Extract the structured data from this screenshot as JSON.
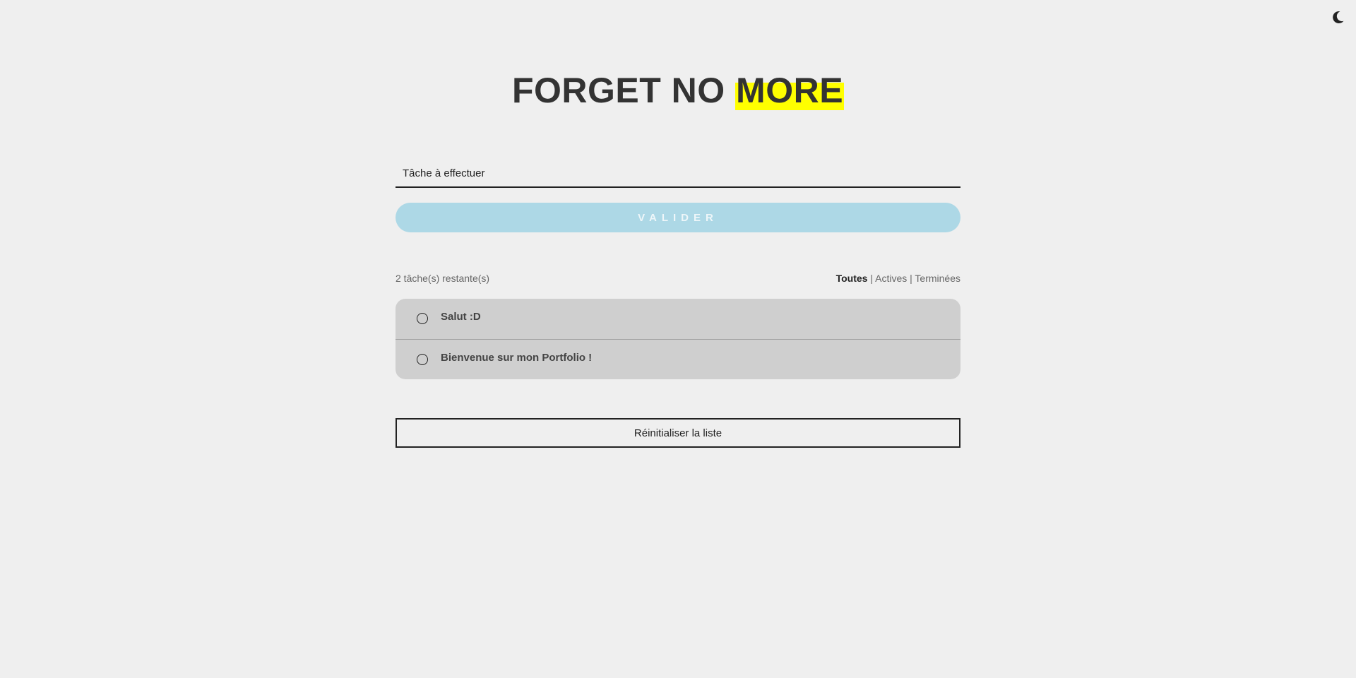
{
  "header": {
    "title_part1": "FORGET NO ",
    "title_highlight": "MORE",
    "theme_icon": "moon-icon"
  },
  "form": {
    "input_placeholder": "Tâche à effectuer",
    "input_value": "",
    "submit_label": "VALIDER"
  },
  "status": {
    "remaining_text": "2 tâche(s) restante(s)"
  },
  "filters": [
    {
      "label": "Toutes",
      "active": true
    },
    {
      "label": "Actives",
      "active": false
    },
    {
      "label": "Terminées",
      "active": false
    }
  ],
  "filter_separator": "|",
  "tasks": [
    {
      "label": "Salut :D",
      "done": false
    },
    {
      "label": "Bienvenue sur mon Portfolio !",
      "done": false
    }
  ],
  "reset_label": "Réinitialiser la liste",
  "colors": {
    "background": "#efefef",
    "highlight": "#ffff00",
    "submit_button": "#add8e6",
    "task_list_bg": "#cfcfcf"
  }
}
